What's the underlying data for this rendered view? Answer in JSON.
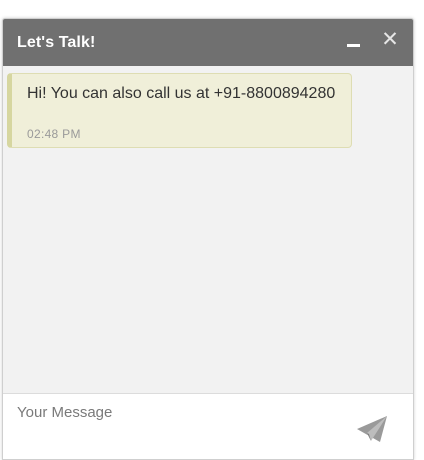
{
  "header": {
    "title": "Let's Talk!",
    "minimize_icon": "minimize-icon",
    "close_glyph": "✕"
  },
  "messages": [
    {
      "text": "Hi! You can also call us at +91-8800894280",
      "time": "02:48 PM"
    }
  ],
  "composer": {
    "placeholder": "Your Message",
    "value": "",
    "send_icon": "paper-plane-icon"
  },
  "colors": {
    "header_bg": "#707070",
    "body_bg": "#f2f2f2",
    "bubble_bg": "#f0efd9",
    "bubble_accent": "#d6d6a0",
    "send_icon": "#9a9a9a"
  }
}
